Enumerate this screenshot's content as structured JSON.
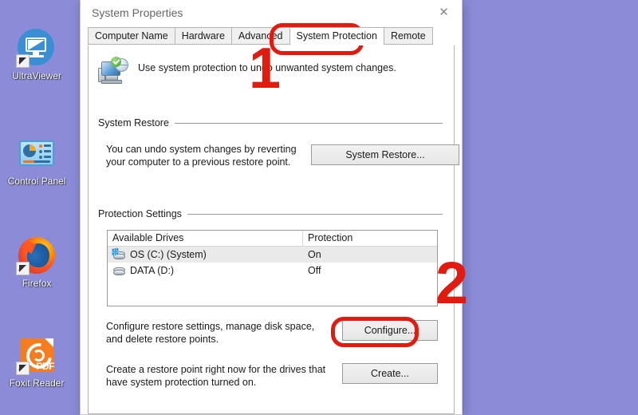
{
  "desktop": {
    "background_color": "#8b8bd8",
    "icons": [
      {
        "label": "UltraViewer",
        "icon": "ultraviewer-icon",
        "has_shortcut_arrow": true
      },
      {
        "label": "Control Panel",
        "icon": "control-panel-icon",
        "has_shortcut_arrow": false
      },
      {
        "label": "Firefox",
        "icon": "firefox-icon",
        "has_shortcut_arrow": true
      },
      {
        "label": "Foxit Reader",
        "icon": "foxit-reader-icon",
        "has_shortcut_arrow": true
      }
    ]
  },
  "window": {
    "title": "System Properties",
    "close_icon": "close-icon",
    "close_glyph": "✕",
    "tabs": [
      {
        "label": "Computer Name",
        "active": false
      },
      {
        "label": "Hardware",
        "active": false
      },
      {
        "label": "Advanced",
        "active": false
      },
      {
        "label": "System Protection",
        "active": true
      },
      {
        "label": "Remote",
        "active": false
      }
    ],
    "hint": {
      "icon": "system-protection-icon",
      "text": "Use system protection to undo unwanted system changes."
    },
    "system_restore": {
      "group_label": "System Restore",
      "description": "You can undo system changes by reverting your computer to a previous restore point.",
      "button_label": "System Restore..."
    },
    "protection_settings": {
      "group_label": "Protection Settings",
      "columns": [
        "Available Drives",
        "Protection"
      ],
      "rows": [
        {
          "drive": "OS (C:) (System)",
          "protection": "On",
          "icon": "system-drive-icon",
          "selected": true
        },
        {
          "drive": "DATA (D:)",
          "protection": "Off",
          "icon": "drive-icon",
          "selected": false
        }
      ],
      "configure": {
        "description": "Configure restore settings, manage disk space, and delete restore points.",
        "button_label": "Configure..."
      },
      "create": {
        "description": "Create a restore point right now for the drives that have system protection turned on.",
        "button_label": "Create..."
      }
    }
  },
  "annotations": {
    "color": "#e01b10",
    "step_one": "1",
    "step_two": "2"
  }
}
